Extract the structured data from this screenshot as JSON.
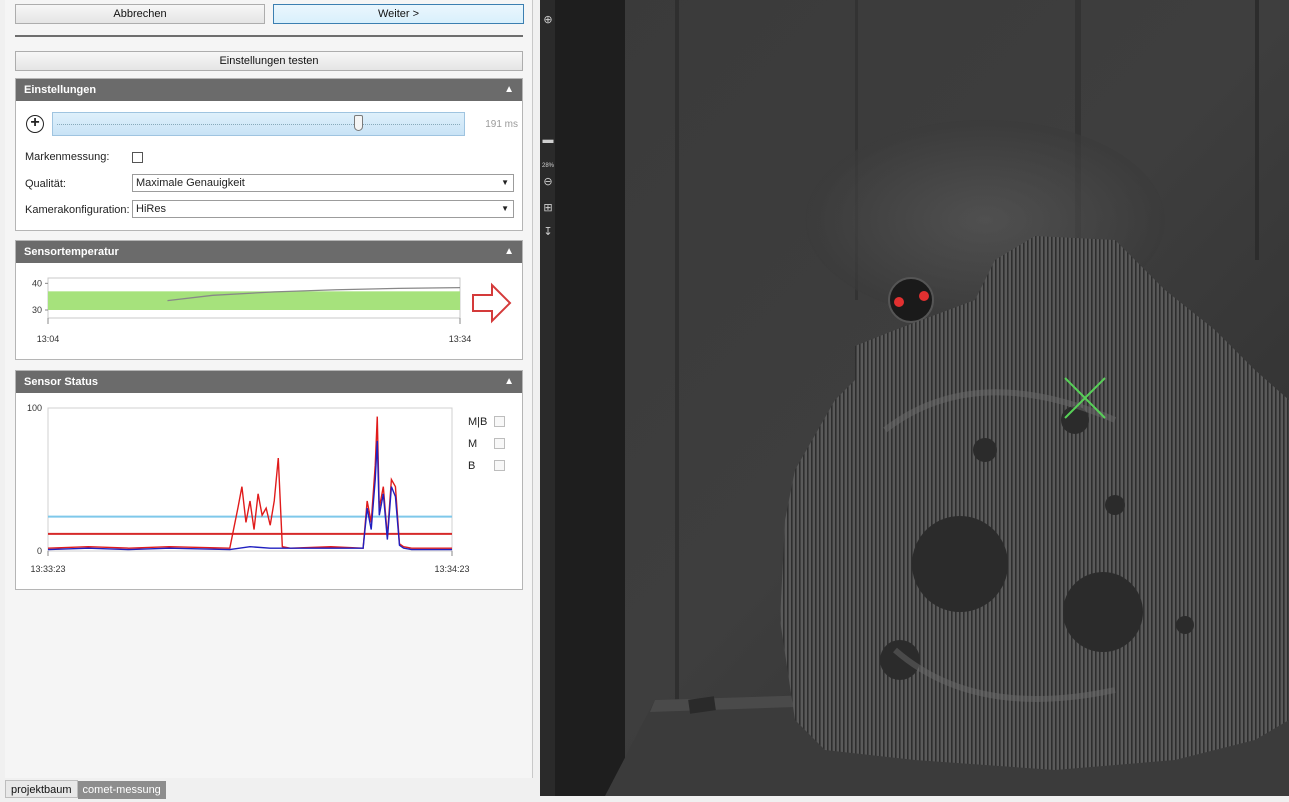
{
  "toolbar": {
    "cancel_label": "Abbrechen",
    "next_label": "Weiter >",
    "test_label": "Einstellungen testen"
  },
  "settings": {
    "title": "Einstellungen",
    "exposure_value": "191 ms",
    "exposure_fraction": 0.75,
    "marker_label": "Markenmessung:",
    "marker_checked": false,
    "quality_label": "Qualität:",
    "quality_value": "Maximale Genauigkeit",
    "camera_label": "Kamerakonfiguration:",
    "camera_value": "HiRes"
  },
  "sensor_temp": {
    "title": "Sensortemperatur"
  },
  "sensor_status": {
    "title": "Sensor Status",
    "legend": [
      "M|B",
      "M",
      "B"
    ]
  },
  "chart_data": [
    {
      "type": "line",
      "xlabel": "",
      "ylabel": "",
      "x_ticks": [
        "13:04",
        "13:34"
      ],
      "y_ticks": [
        30,
        40
      ],
      "ylim": [
        27,
        42
      ],
      "band": [
        30,
        37
      ],
      "series": [
        {
          "x": [
            0.29,
            0.4,
            0.55,
            0.7,
            0.85,
            1.0
          ],
          "values": [
            33.5,
            35.5,
            36.8,
            37.6,
            38.1,
            38.4
          ]
        }
      ],
      "band_color": "#a6e27c",
      "line_color": "#888888"
    },
    {
      "type": "line",
      "x_ticks": [
        "13:33:23",
        "13:34:23"
      ],
      "y_ticks": [
        0,
        100
      ],
      "ylim": [
        0,
        100
      ],
      "thresholds": [
        {
          "value": 24,
          "color": "#7ec8ea"
        },
        {
          "value": 12,
          "color": "#d62a2a"
        }
      ],
      "series": [
        {
          "color": "#e01b1b",
          "x": [
            0,
            0.1,
            0.2,
            0.3,
            0.45,
            0.47,
            0.48,
            0.49,
            0.5,
            0.51,
            0.52,
            0.53,
            0.54,
            0.55,
            0.56,
            0.57,
            0.58,
            0.6,
            0.7,
            0.78,
            0.79,
            0.8,
            0.81,
            0.815,
            0.82,
            0.83,
            0.84,
            0.85,
            0.86,
            0.87,
            0.88,
            0.9,
            1.0
          ],
          "values": [
            2,
            3,
            2,
            3,
            2,
            30,
            45,
            20,
            35,
            15,
            40,
            25,
            30,
            18,
            35,
            65,
            3,
            2,
            3,
            2,
            35,
            20,
            60,
            94,
            30,
            45,
            10,
            50,
            45,
            5,
            3,
            2,
            2
          ]
        },
        {
          "color": "#2020c0",
          "x": [
            0,
            0.1,
            0.2,
            0.3,
            0.45,
            0.5,
            0.55,
            0.6,
            0.7,
            0.78,
            0.79,
            0.8,
            0.81,
            0.815,
            0.82,
            0.83,
            0.84,
            0.85,
            0.86,
            0.87,
            0.88,
            0.9,
            1.0
          ],
          "values": [
            1,
            2,
            1,
            2,
            1,
            3,
            2,
            2,
            2,
            2,
            30,
            15,
            50,
            77,
            25,
            40,
            8,
            45,
            38,
            4,
            2,
            1,
            1
          ]
        }
      ]
    }
  ],
  "bottom_tabs": [
    "projektbaum",
    "comet-messung"
  ],
  "viewer_zoom": "28%"
}
